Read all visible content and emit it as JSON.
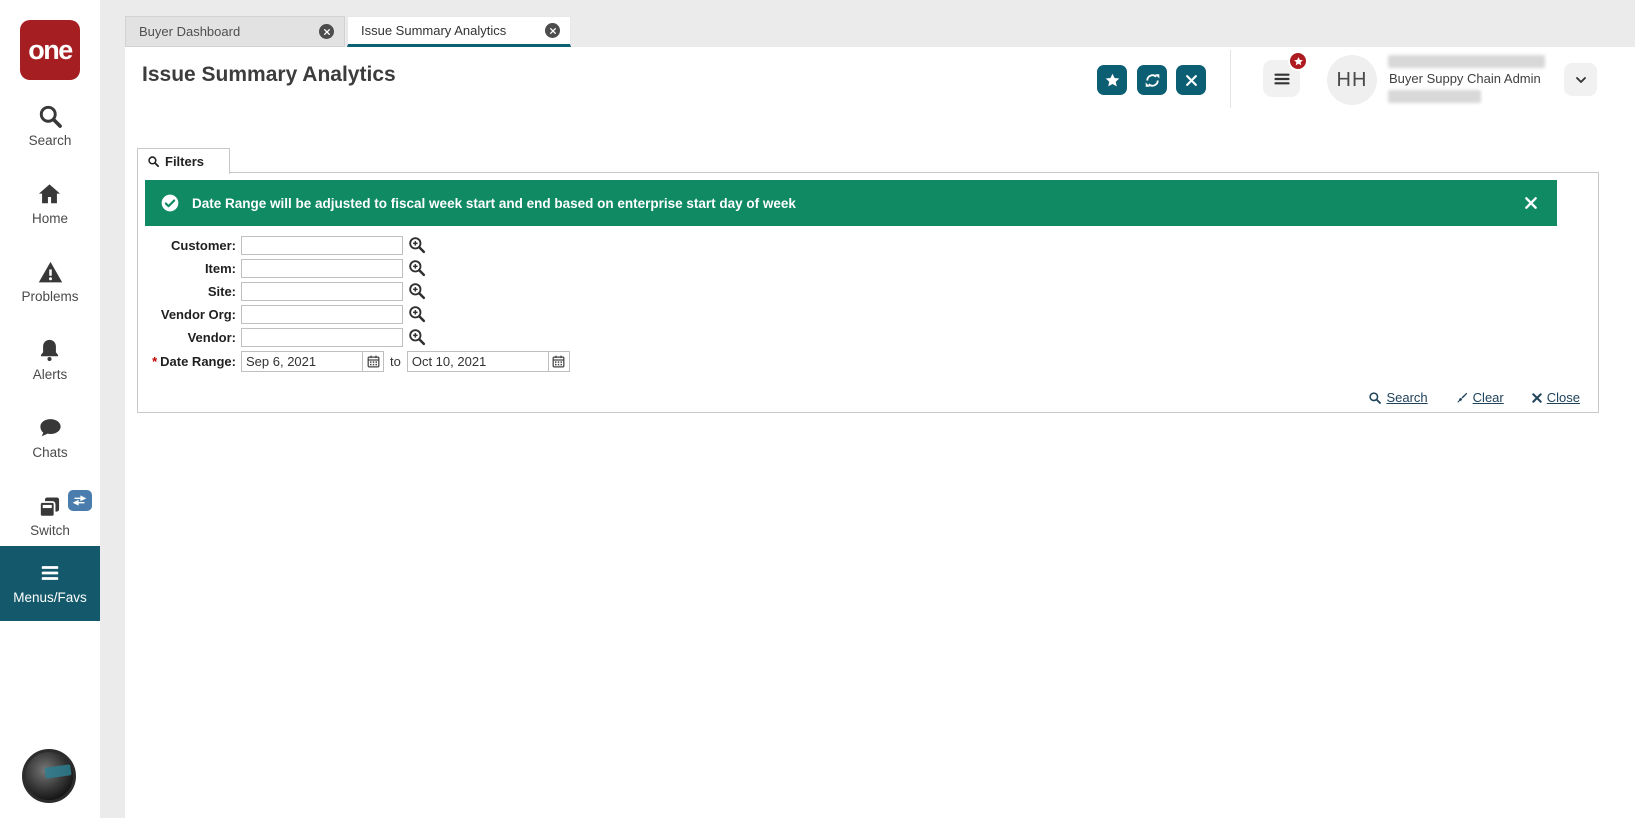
{
  "colors": {
    "accent_teal": "#0c5e72",
    "menu_teal": "#14596b",
    "banner_green": "#0f8a63",
    "logo_red": "#a51e22",
    "badge_red": "#ae1c22",
    "switch_badge_blue": "#4a7dad",
    "link_color": "#20435c"
  },
  "sidebar": {
    "logo_text": "one",
    "items": [
      {
        "label": "Search",
        "icon": "search-icon"
      },
      {
        "label": "Home",
        "icon": "home-icon"
      },
      {
        "label": "Problems",
        "icon": "warning-triangle-icon"
      },
      {
        "label": "Alerts",
        "icon": "bell-icon"
      },
      {
        "label": "Chats",
        "icon": "chat-bubble-icon"
      },
      {
        "label": "Switch",
        "icon": "switch-windows-icon",
        "badge_icon": "swap-arrows-icon"
      }
    ],
    "menus_favs_label": "Menus/Favs"
  },
  "tab_bar": {
    "tabs": [
      {
        "label": "Buyer Dashboard",
        "active": false
      },
      {
        "label": "Issue Summary Analytics",
        "active": true
      }
    ]
  },
  "header": {
    "title": "Issue Summary Analytics",
    "action_buttons": [
      {
        "icon": "star-icon"
      },
      {
        "icon": "refresh-icon"
      },
      {
        "icon": "close-icon"
      }
    ],
    "user": {
      "initials": "HH",
      "role": "Buyer Suppy Chain Admin"
    }
  },
  "filters_panel": {
    "tab_label": "Filters",
    "banner": {
      "icon": "check-circle-icon",
      "text": "Date Range will be adjusted to fiscal week start and end based on enterprise start day of week",
      "close_icon": "close-x-icon"
    },
    "fields": [
      {
        "label": "Customer:",
        "value": "",
        "icon": "zoom-in-icon"
      },
      {
        "label": "Item:",
        "value": "",
        "icon": "zoom-in-icon"
      },
      {
        "label": "Site:",
        "value": "",
        "icon": "zoom-in-icon"
      },
      {
        "label": "Vendor Org:",
        "value": "",
        "icon": "zoom-in-icon"
      },
      {
        "label": "Vendor:",
        "value": "",
        "icon": "zoom-in-icon"
      }
    ],
    "date_range": {
      "required_marker": "*",
      "label": "Date Range:",
      "from_value": "Sep 6, 2021",
      "separator": "to",
      "to_value": "Oct 10, 2021",
      "icon": "calendar-icon"
    },
    "actions": [
      {
        "label": "Search",
        "icon": "search-icon"
      },
      {
        "label": "Clear",
        "icon": "clear-brush-icon"
      },
      {
        "label": "Close",
        "icon": "close-x-icon"
      }
    ]
  }
}
